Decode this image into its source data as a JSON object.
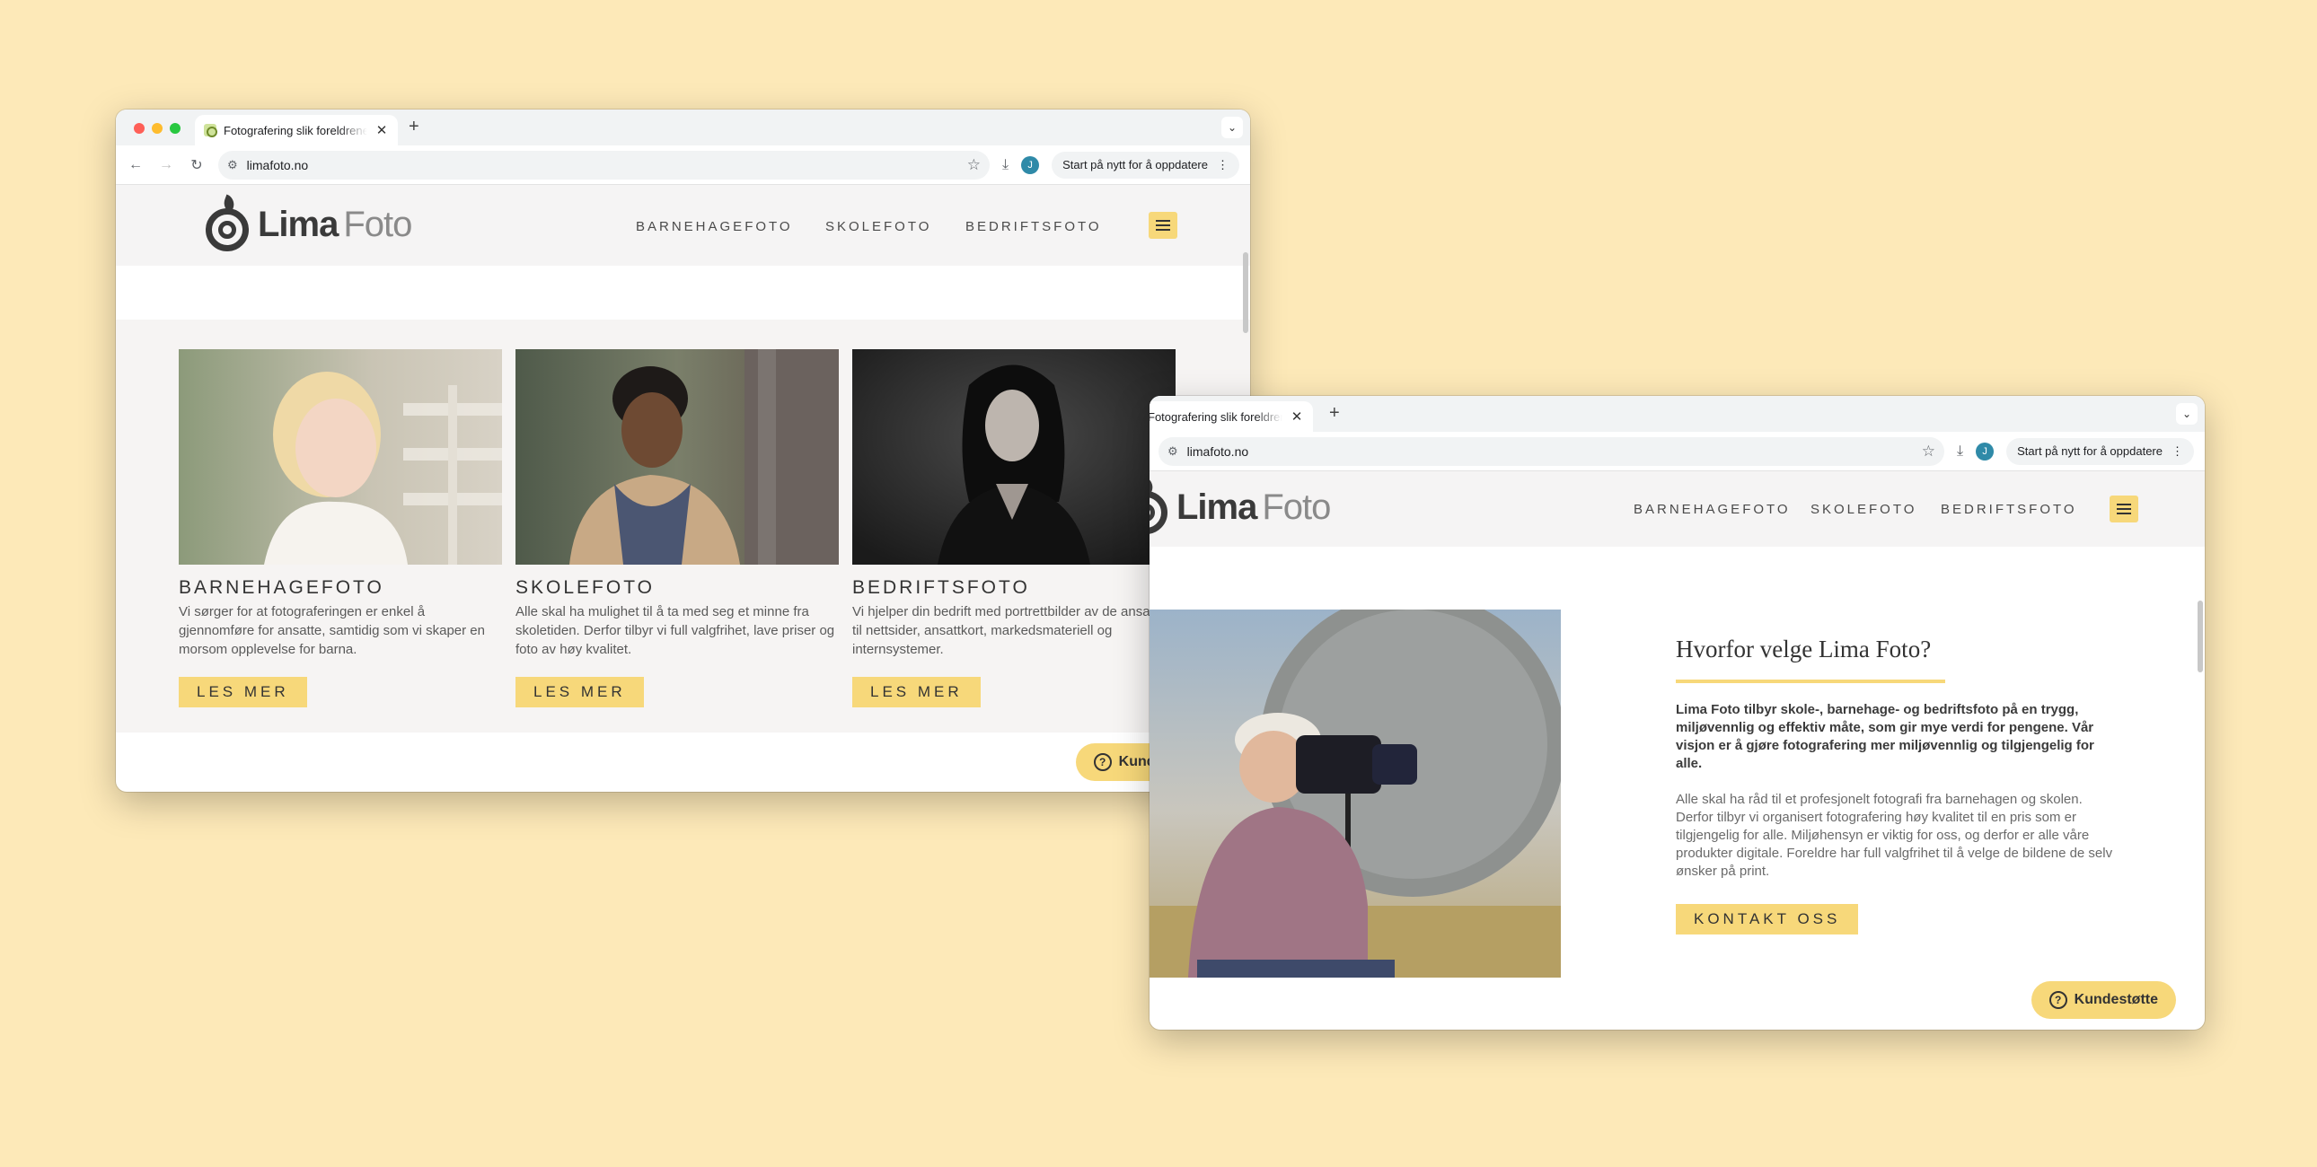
{
  "colors": {
    "background": "#fde9b8",
    "accent": "#f7d87a",
    "text": "#333333"
  },
  "browser": {
    "tab_title": "Fotografering slik foreldrene ønsker",
    "url": "limafoto.no",
    "profile_initial": "J",
    "update_label": "Start på nytt for å oppdatere",
    "icons": {
      "back": "back-arrow-icon",
      "forward": "forward-arrow-icon",
      "reload": "reload-icon",
      "bookmark": "star-icon",
      "download": "download-icon",
      "menu": "kebab-menu-icon"
    }
  },
  "site": {
    "logo": {
      "lima": "Lima",
      "foto": "Foto"
    },
    "menu": [
      "BARNEHAGEFOTO",
      "SKOLEFOTO",
      "BEDRIFTSFOTO"
    ],
    "support_label": "Kundestøtte"
  },
  "cards": [
    {
      "title": "BARNEHAGEFOTO",
      "text": "Vi sørger for at fotograferingen er enkel å gjennomføre for ansatte, samtidig som vi skaper en morsom opplevelse for barna.",
      "button": "LES MER"
    },
    {
      "title": "SKOLEFOTO",
      "text": "Alle skal ha mulighet til å ta med seg et minne fra skoletiden. Derfor tilbyr vi full valgfrihet, lave priser og foto av høy kvalitet.",
      "button": "LES MER"
    },
    {
      "title": "BEDRIFTSFOTO",
      "text": "Vi hjelper din bedrift med portrettbilder av de ansatte til nettsider, ansattkort, markedsmateriell og internsystemer.",
      "button": "LES MER"
    }
  ],
  "about": {
    "heading": "Hvorfor velge Lima Foto?",
    "lead": "Lima Foto tilbyr skole-, barnehage- og bedriftsfoto på en trygg, miljøvennlig og effektiv måte, som gir mye verdi for pengene. Vår visjon er å gjøre fotografering mer miljøvennlig og tilgjengelig for alle.",
    "body": "Alle skal ha råd til et profesjonelt fotografi fra barnehagen og skolen. Derfor tilbyr vi organisert fotografering høy kvalitet til en pris som er tilgjengelig for alle. Miljøhensyn er viktig for oss, og derfor er alle våre produkter digitale. Foreldre har full valgfrihet til å velge de bildene de selv ønsker på print.",
    "button": "KONTAKT OSS"
  }
}
